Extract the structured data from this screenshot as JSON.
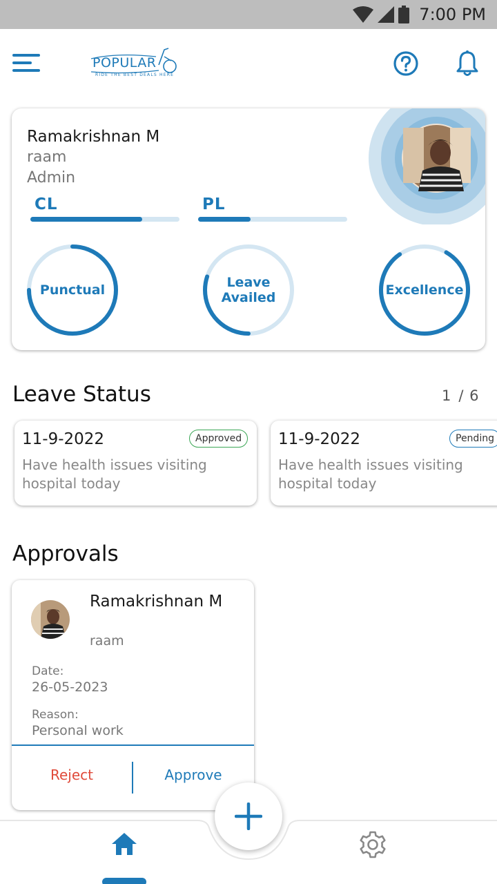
{
  "status_bar": {
    "time": "7:00 PM"
  },
  "app": {
    "logo_text": "POPULAR",
    "logo_tagline": "RIDE THE BEST DEALS HERE"
  },
  "profile": {
    "name": "Ramakrishnan M",
    "username": "raam",
    "role": "Admin",
    "leave_bars": [
      {
        "label": "CL",
        "fraction": 0.75
      },
      {
        "label": "PL",
        "fraction": 0.35
      }
    ],
    "rings": [
      {
        "label": "Punctual",
        "fraction": 0.75
      },
      {
        "label": "Leave Availed",
        "fraction": 0.3
      },
      {
        "label": "Excellence",
        "fraction": 0.82
      }
    ]
  },
  "leave_status": {
    "title": "Leave Status",
    "page_current": "1",
    "page_total": "/ 6",
    "cards": [
      {
        "date": "11-9-2022",
        "status": "Approved",
        "reason": "Have health issues visiting hospital today"
      },
      {
        "date": "11-9-2022",
        "status": "Pending",
        "reason": "Have health issues visiting hospital today"
      }
    ]
  },
  "approvals": {
    "title": "Approvals",
    "card": {
      "name": "Ramakrishnan M",
      "username": "raam",
      "date_label": "Date:",
      "date_value": "26-05-2023",
      "reason_label": "Reason:",
      "reason_value": "Personal work",
      "reject_label": "Reject",
      "approve_label": "Approve"
    }
  },
  "colors": {
    "accent": "#1e7ab8",
    "track": "#d4e6f2",
    "approved": "#3aa655",
    "reject": "#e04a3a"
  },
  "icons": [
    "menu-icon",
    "help-icon",
    "bell-icon",
    "add-icon",
    "home-icon",
    "settings-icon"
  ]
}
